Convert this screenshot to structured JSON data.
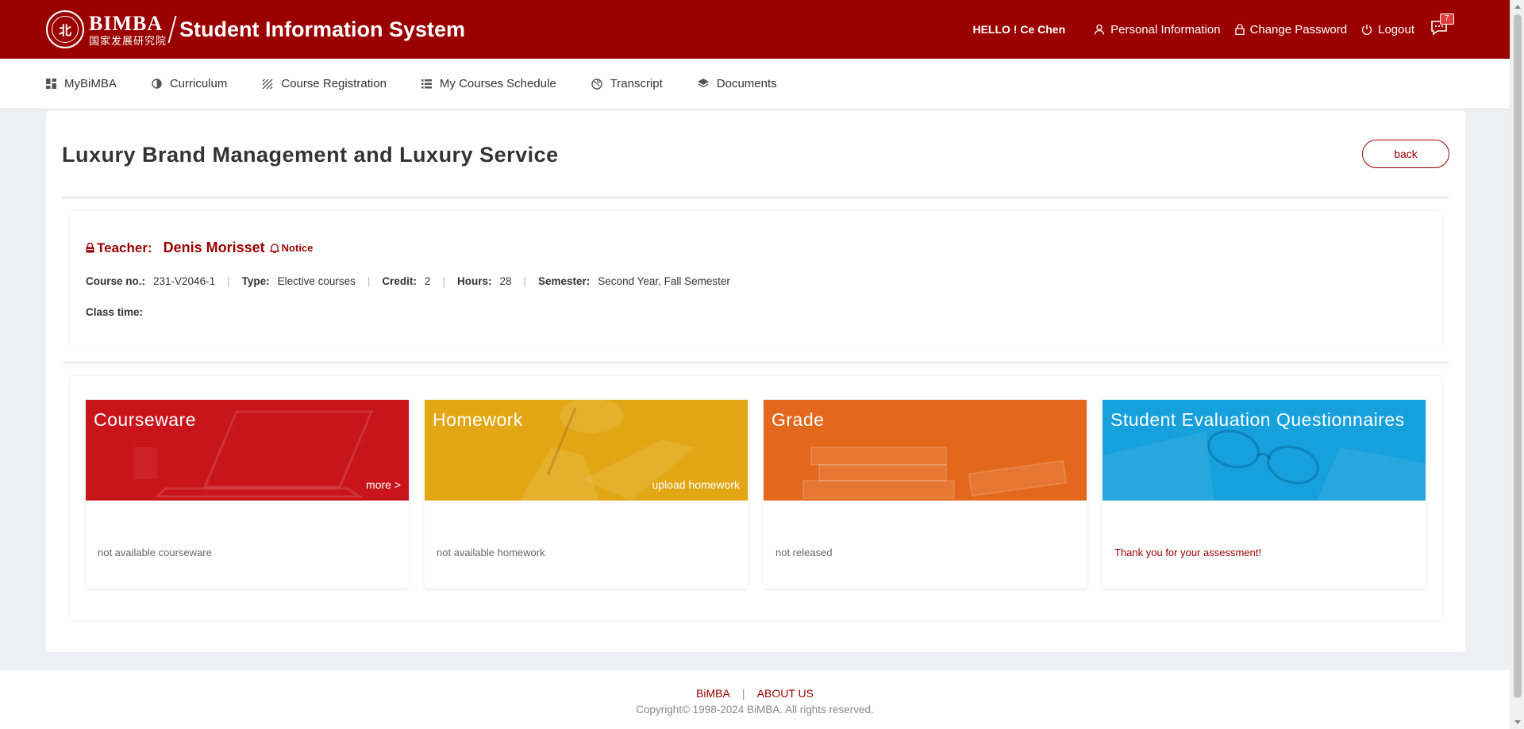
{
  "header": {
    "brand_en": "BIMBA",
    "brand_cn": "国家发展研究院",
    "system_title": "Student Information System",
    "greeting": "HELLO ! Ce Chen",
    "personal_info": "Personal Information",
    "change_password": "Change Password",
    "logout": "Logout",
    "message_count": "7"
  },
  "nav": {
    "items": [
      {
        "label": "MyBiMBA",
        "icon": "dashboard-icon"
      },
      {
        "label": "Curriculum",
        "icon": "half-circle-icon"
      },
      {
        "label": "Course Registration",
        "icon": "hatch-icon"
      },
      {
        "label": "My Courses Schedule",
        "icon": "list-icon"
      },
      {
        "label": "Transcript",
        "icon": "globe-icon"
      },
      {
        "label": "Documents",
        "icon": "layers-icon"
      }
    ]
  },
  "course": {
    "title": "Luxury Brand Management and Luxury Service",
    "back_label": "back",
    "teacher_label": "Teacher:",
    "teacher_name": "Denis Morisset",
    "notice_label": "Notice",
    "course_no_label": "Course no.:",
    "course_no": "231-V2046-1",
    "type_label": "Type:",
    "type": "Elective courses",
    "credit_label": "Credit:",
    "credit": "2",
    "hours_label": "Hours:",
    "hours": "28",
    "semester_label": "Semester:",
    "semester": "Second Year, Fall Semester",
    "class_time_label": "Class time:"
  },
  "tiles": [
    {
      "title": "Courseware",
      "link": "more >",
      "body": "not available courseware",
      "color": "#c8141a"
    },
    {
      "title": "Homework",
      "link": "upload homework",
      "body": "not available homework",
      "color": "#e3a715"
    },
    {
      "title": "Grade",
      "link": "",
      "body": "not released",
      "color": "#e4681b"
    },
    {
      "title": "Student Evaluation Questionnaires",
      "link": "",
      "body": "Thank you for your assessment!",
      "color": "#16a0dc"
    }
  ],
  "footer": {
    "link1": "BiMBA",
    "link2": "ABOUT US",
    "copyright": "Copyright© 1998-2024 BiMBA. All rights reserved."
  }
}
